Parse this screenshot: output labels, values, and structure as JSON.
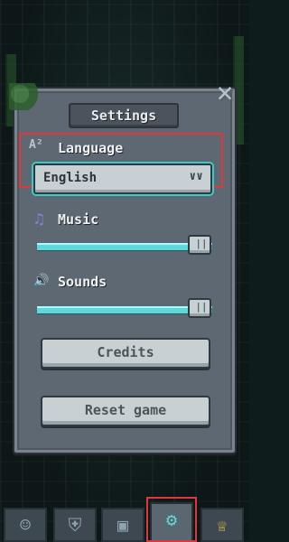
{
  "settings": {
    "title": "Settings",
    "close_icon": "close-icon",
    "language": {
      "label": "Language",
      "icon": "language-icon",
      "icon_text": "A²",
      "selected": "English",
      "chevron": "∨∨"
    },
    "music": {
      "label": "Music",
      "icon": "music-note-icon",
      "icon_text": "♫",
      "level": 0.93
    },
    "sounds": {
      "label": "Sounds",
      "icon": "speaker-icon",
      "icon_text": "🔊",
      "level": 0.93
    },
    "credits_label": "Credits",
    "reset_label": "Reset game"
  },
  "nav": {
    "tabs": [
      {
        "name": "character-tab",
        "icon": "character-icon",
        "glyph": "☺"
      },
      {
        "name": "armor-tab",
        "icon": "armor-icon",
        "glyph": "⛨"
      },
      {
        "name": "controller-tab",
        "icon": "gamepad-icon",
        "glyph": "▣"
      },
      {
        "name": "settings-tab",
        "icon": "gear-icon",
        "glyph": "⚙"
      },
      {
        "name": "trophy-tab",
        "icon": "trophy-icon",
        "glyph": "♕"
      }
    ],
    "active": 3
  },
  "colors": {
    "accent": "#5fd8dd",
    "highlight": "#e0383a",
    "panel": "#5e6873"
  }
}
